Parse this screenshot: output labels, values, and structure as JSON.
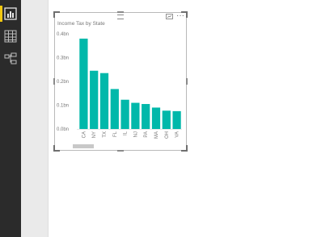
{
  "rail": {
    "items": [
      {
        "id": "report",
        "icon": "bar-chart-icon",
        "active": true
      },
      {
        "id": "data",
        "icon": "table-grid-icon",
        "active": false
      },
      {
        "id": "model",
        "icon": "relationships-icon",
        "active": false
      }
    ]
  },
  "visual": {
    "more_label": "···"
  },
  "chart_data": {
    "type": "bar",
    "title": "Income Tax by State",
    "categories": [
      "CA",
      "NY",
      "TX",
      "FL",
      "IL",
      "NJ",
      "PA",
      "MA",
      "OH",
      "VA"
    ],
    "values": [
      0.38,
      0.245,
      0.235,
      0.168,
      0.123,
      0.11,
      0.105,
      0.09,
      0.077,
      0.075
    ],
    "yticks": [
      "0.0bn",
      "0.1bn",
      "0.2bn",
      "0.3bn",
      "0.4bn"
    ],
    "ylim": [
      0,
      0.4
    ],
    "grid": false,
    "colors": {
      "bar": "#01b8aa",
      "axis_text": "#777777"
    }
  },
  "scroll": {
    "position": 0.0
  }
}
